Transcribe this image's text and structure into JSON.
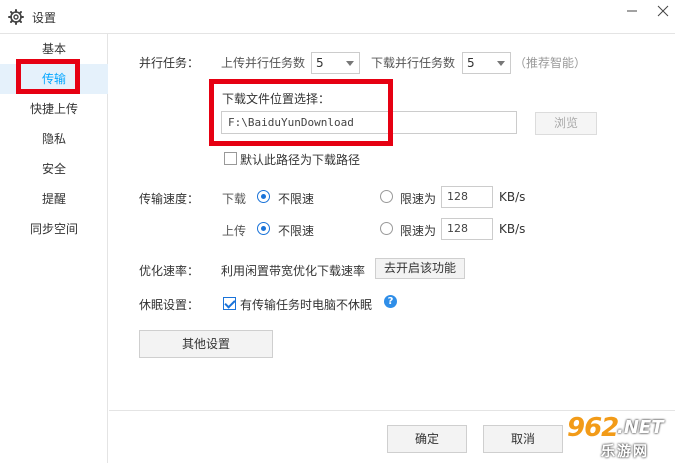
{
  "window": {
    "title": "设置",
    "icons": {
      "app": "gear-icon",
      "minimize": "minimize-icon",
      "close": "close-icon"
    }
  },
  "sidebar": {
    "items": [
      {
        "label": "基本",
        "active": false
      },
      {
        "label": "传输",
        "active": true
      },
      {
        "label": "快捷上传",
        "active": false
      },
      {
        "label": "隐私",
        "active": false
      },
      {
        "label": "安全",
        "active": false
      },
      {
        "label": "提醒",
        "active": false
      },
      {
        "label": "同步空间",
        "active": false
      }
    ],
    "active_color": "#06a7ff",
    "active_bg": "#e5f1fb"
  },
  "parallel": {
    "section_label": "并行任务：",
    "upload_label": "上传并行任务数",
    "upload_value": "5",
    "download_label": "下载并行任务数",
    "download_value": "5",
    "hint": "（推荐智能）"
  },
  "download_location": {
    "label": "下载文件位置选择：",
    "path": "F:\\BaiduYunDownload",
    "browse_label": "浏览",
    "browse_disabled": true,
    "default_checkbox_label": "默认此路径为下载路径",
    "default_checked": false
  },
  "speed": {
    "section_label": "传输速度：",
    "download": {
      "label": "下载",
      "unlimited_label": "不限速",
      "unlimited_selected": true,
      "limit_label": "限速为",
      "limit_value": "128",
      "unit": "KB/s"
    },
    "upload": {
      "label": "上传",
      "unlimited_label": "不限速",
      "unlimited_selected": true,
      "limit_label": "限速为",
      "limit_value": "128",
      "unit": "KB/s"
    }
  },
  "optimize": {
    "section_label": "优化速率：",
    "text": "利用闲置带宽优化下载速率",
    "button_label": "去开启该功能"
  },
  "sleep": {
    "section_label": "休眠设置：",
    "checkbox_label": "有传输任务时电脑不休眠",
    "checked": true,
    "help_icon": "question-icon",
    "help_glyph": "?"
  },
  "other_settings_label": "其他设置",
  "footer": {
    "ok_label": "确定",
    "cancel_label": "取消"
  },
  "annotation_color": "#e60012",
  "watermark": {
    "number": "962",
    "domain": ".NET",
    "text": "乐游网"
  }
}
